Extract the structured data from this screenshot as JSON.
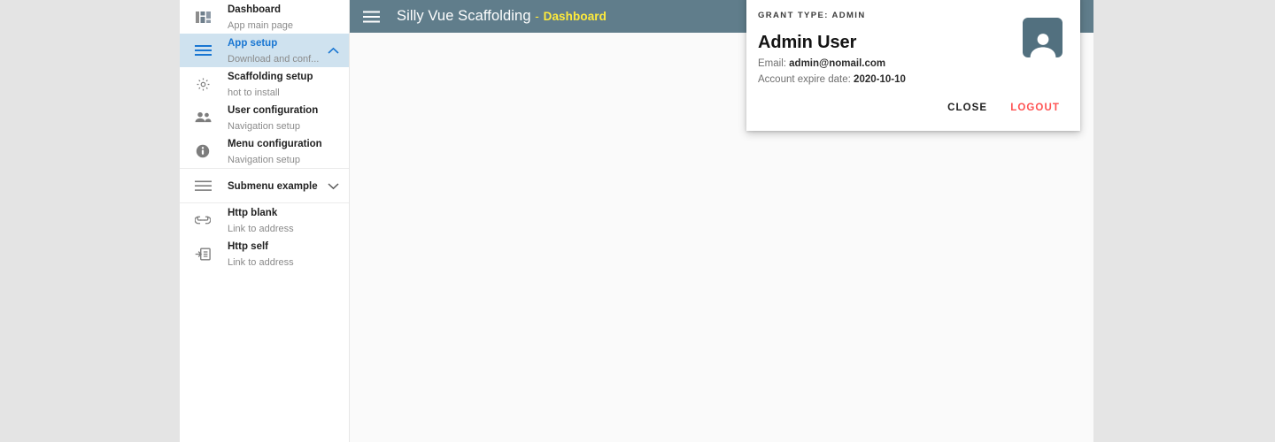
{
  "appbar": {
    "menu_icon": "hamburger-menu-icon",
    "title": "Silly Vue Scaffolding",
    "separator": "-",
    "page": "Dashboard",
    "bg_color": "#607d8b",
    "accent_color": "#ffeb3b"
  },
  "sidebar": {
    "active_color": "#1976d2",
    "active_bg": "#cfe2ef",
    "items": [
      {
        "icon": "dashboard-icon",
        "title": "Dashboard",
        "subtitle": "App main page",
        "active": false,
        "chevron": ""
      },
      {
        "icon": "menu-lines-icon",
        "title": "App setup",
        "subtitle": "Download and conf...",
        "active": true,
        "chevron": "up"
      },
      {
        "icon": "gear-icon",
        "title": "Scaffolding setup",
        "subtitle": "hot to install",
        "active": false,
        "chevron": ""
      },
      {
        "icon": "people-icon",
        "title": "User configuration",
        "subtitle": "Navigation setup",
        "active": false,
        "chevron": ""
      },
      {
        "icon": "info-icon",
        "title": "Menu configuration",
        "subtitle": "Navigation setup",
        "active": false,
        "chevron": ""
      },
      {
        "icon": "list-icon",
        "title": "Submenu example",
        "subtitle": "",
        "active": false,
        "chevron": "down"
      },
      {
        "icon": "link-icon",
        "title": "Http blank",
        "subtitle": "Link to address",
        "active": false,
        "chevron": ""
      },
      {
        "icon": "login-box-icon",
        "title": "Http self",
        "subtitle": "Link to address",
        "active": false,
        "chevron": ""
      }
    ]
  },
  "user_card": {
    "grant_type": "GRANT TYPE: ADMIN",
    "name": "Admin User",
    "email_label": "Email:",
    "email_value": "admin@nomail.com",
    "expire_label": "Account expire date:",
    "expire_value": "2020-10-10",
    "avatar_icon": "person-avatar-icon",
    "avatar_color": "#52707f",
    "close_label": "Close",
    "logout_label": "Logout",
    "logout_color": "#ff5252"
  }
}
